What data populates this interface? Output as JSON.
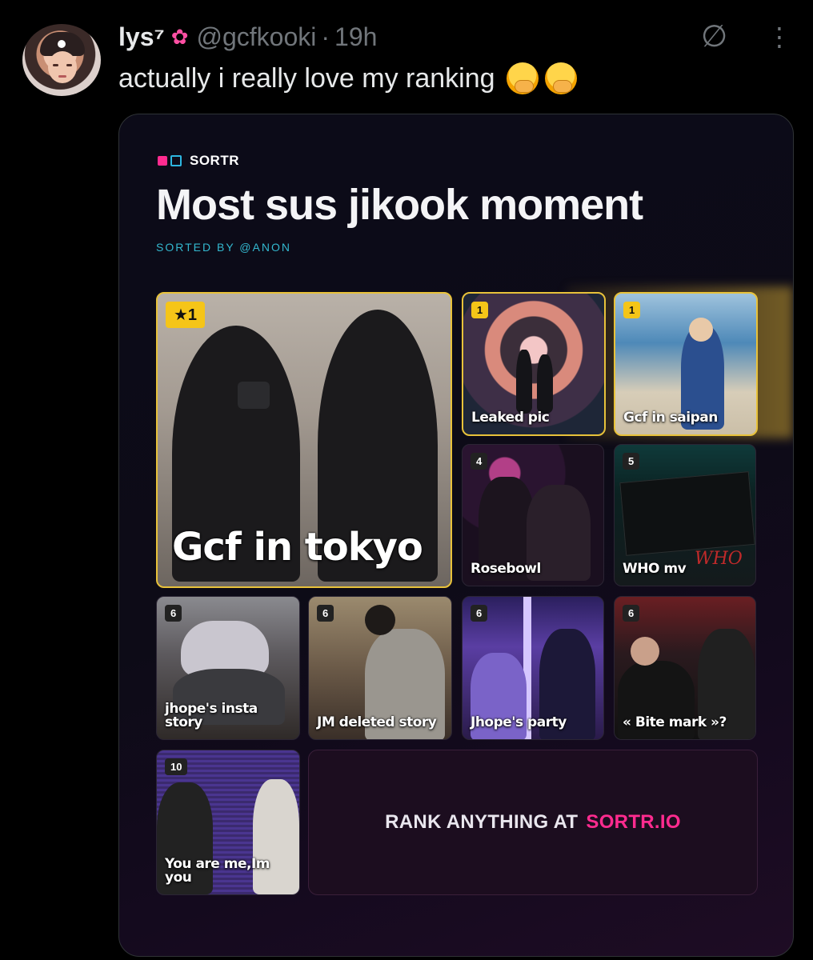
{
  "tweet": {
    "display_name": "lys⁷",
    "name_icon": "lotus-icon",
    "handle": "@gcfkooki",
    "separator": "·",
    "time": "19h",
    "text": "actually i really love my ranking",
    "emojis": [
      "hand-over-mouth-emoji",
      "hand-over-mouth-emoji"
    ],
    "icons": [
      "grok-icon",
      "more-icon"
    ]
  },
  "card": {
    "brand": "SORTR",
    "title": "Most sus jikook moment",
    "sorted_by": "SORTED BY @ANON",
    "cta_prefix": "RANK ANYTHING AT",
    "cta_link": "SORTR.IO",
    "colors": {
      "accent_pink": "#ff2b8f",
      "accent_cyan": "#2db6e0",
      "gold": "#f5c518"
    }
  },
  "rankings": [
    {
      "rank": "★1",
      "label": "Gcf in tokyo"
    },
    {
      "rank": "1",
      "label": "Leaked pic"
    },
    {
      "rank": "1",
      "label": "Gcf in saipan"
    },
    {
      "rank": "4",
      "label": "Rosebowl"
    },
    {
      "rank": "5",
      "label": "WHO mv"
    },
    {
      "rank": "6",
      "label": "jhope's insta story"
    },
    {
      "rank": "6",
      "label": "JM deleted story"
    },
    {
      "rank": "6",
      "label": "Jhope's party"
    },
    {
      "rank": "6",
      "label": "« Bite mark »?"
    },
    {
      "rank": "10",
      "label": "You are me,Im you"
    }
  ]
}
